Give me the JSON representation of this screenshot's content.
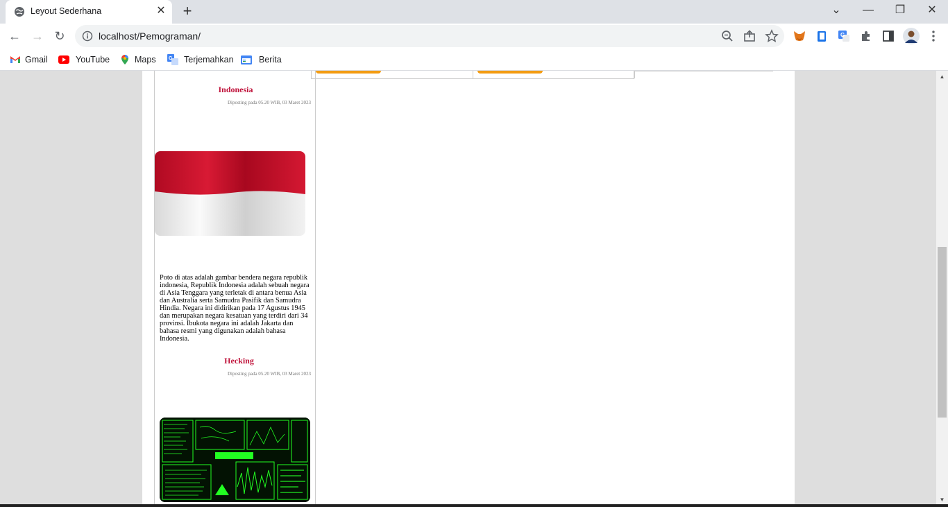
{
  "tab": {
    "title": "Leyout Sederhana",
    "close": "✕",
    "new": "+"
  },
  "window": {
    "dropdown": "⌄",
    "minimize": "—",
    "restore": "❐",
    "close": "✕"
  },
  "nav": {
    "back": "←",
    "forward": "→",
    "reload": "↻"
  },
  "omnibox": {
    "url": "localhost/Pemograman/"
  },
  "bookmarks": [
    {
      "label": "Gmail"
    },
    {
      "label": "YouTube"
    },
    {
      "label": "Maps"
    },
    {
      "label": "Terjemahkan"
    },
    {
      "label": "Berita"
    }
  ],
  "posts": [
    {
      "title": "Indonesia",
      "date": "Diposting pada 05.20 WIB, 03 Maret 2023",
      "text": "Poto di atas adalah gambar bendera negara republik indonesia, Republik Indonesia adalah sebuah negara di Asia Tenggara yang terletak di antara benua Asia dan Australia serta Samudra Pasifik dan Samudra Hindia. Negara ini didirikan pada 17 Agustus 1945 dan merupakan negara kesatuan yang terdiri dari 34 provinsi. Ibukota negara ini adalah Jakarta dan bahasa resmi yang digunakan adalah bahasa Indonesia."
    },
    {
      "title": "Hecking",
      "date": "Diposting pada 05.20 WIB, 03 Maret 2023"
    }
  ],
  "colors": {
    "post_title": "#c0143c",
    "accent": "#f39c12",
    "flag_red": "#c8102e"
  },
  "icons": [
    "globe-icon",
    "info-icon",
    "zoom-icon",
    "share-icon",
    "star-icon",
    "metamask-icon",
    "reader-icon",
    "translate-icon",
    "extensions-icon",
    "sidepanel-icon",
    "avatar",
    "menu-icon"
  ]
}
